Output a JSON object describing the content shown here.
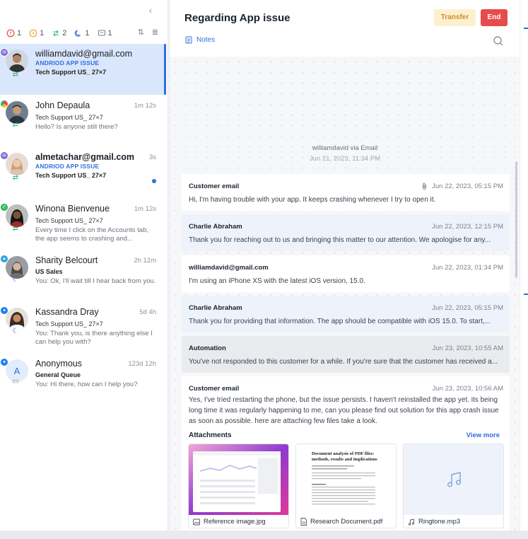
{
  "sidebar": {
    "filters": [
      {
        "icon": "alert-circle-icon",
        "count": "1",
        "color": "#e84b4b"
      },
      {
        "icon": "clock-icon",
        "count": "1",
        "color": "#f0a23a"
      },
      {
        "icon": "transfer-icon",
        "count": "2",
        "color": "#2db36b"
      },
      {
        "icon": "moon-icon",
        "count": "1",
        "color": "#2f6fe0"
      },
      {
        "icon": "message-icon",
        "count": "1",
        "color": "#7b8290"
      }
    ],
    "conversations": [
      {
        "name": "williamdavid@gmail.com",
        "tags": "ANDRIOD  APP ISSUE",
        "queue": "Tech Support US_ 27×7",
        "preview": "",
        "time": "",
        "channel": "email",
        "status": "transfer"
      },
      {
        "name": "John Depaula",
        "tags": "",
        "queue": "Tech Support US_ 27×7",
        "preview": "Hello? Is anyone still there?",
        "time": "1m 12s",
        "channel": "chrome",
        "status": "transfer"
      },
      {
        "name": "almetachar@gmail.com",
        "tags": "ANDRIOD  APP ISSUE",
        "queue": "Tech Support US_ 27×7",
        "preview": "",
        "time": "3s",
        "channel": "email",
        "status": "transfer"
      },
      {
        "name": "Winona Bienvenue",
        "tags": "",
        "queue": "Tech Support US_ 27×7",
        "preview": "Every time I click on the Accounts tab, the app seems to crashing and...",
        "time": "1m 12s",
        "channel": "whatsapp",
        "status": "transfer"
      },
      {
        "name": "Sharity Belcourt",
        "tags": "",
        "queue": "US Sales",
        "preview": "You: Ok, I'll wait till I hear back from you.",
        "time": "2h 12m",
        "channel": "telegram",
        "status": "moon"
      },
      {
        "name": "Kassandra Dray",
        "tags": "",
        "queue": "Tech Support US_ 27×7",
        "preview": "You: Thank you, is there anything else I can help you with?",
        "time": "5d 4h",
        "channel": "messenger",
        "status": "moon"
      },
      {
        "name": "Anonymous",
        "tags": "",
        "queue": "General Queue",
        "preview": "You: Hi there, how can I help you?",
        "time": "123d 12h",
        "channel": "messenger",
        "status": "message",
        "initial": "A"
      }
    ]
  },
  "header": {
    "title": "Regarding App issue",
    "transfer_label": "Transfer",
    "end_label": "End",
    "notes_label": "Notes"
  },
  "thread": {
    "banner_source": "williamdavid via Email",
    "banner_date": "Jun 21, 2023, 11:34 PM",
    "messages": [
      {
        "sender": "Customer email",
        "date": "Jun 22, 2023, 05:15 PM",
        "body": "Hi, I'm having trouble with your app. It keeps crashing whenever I try to open it.",
        "has_attachment_icon": true
      },
      {
        "sender": "Charlie Abraham",
        "date": "Jun 22, 2023, 12:15 PM",
        "body": "Thank you for reaching out to us and bringing this matter to our attention. We apologise for any..."
      },
      {
        "sender": "williamdavid@gmail.com",
        "date": "Jun 22, 2023, 01:34 PM",
        "body": "I'm using an iPhone XS with the latest iOS version, 15.0."
      },
      {
        "sender": "Charlie Abraham",
        "date": "Jun 22, 2023, 05:15 PM",
        "body": "Thank you for providing that information. The app should be compatible with iOS 15.0. To start,..."
      },
      {
        "sender": "Automation",
        "date": "Jun 23, 2023, 10:55 AM",
        "body": "You've not responded to this customer for a while. If you're sure that the customer has received a..."
      },
      {
        "sender": "Customer email",
        "date": "Jun 23, 2023, 10:56 AM",
        "body": "Yes, I've tried restarting the phone, but the issue persists. I haven't reinstalled the app yet. its being long time it was regularly happening to me, can you please find out solution for this app crash issue as soon as possible. here are attaching few files take a look."
      }
    ],
    "attachments_label": "Attachments",
    "view_more_label": "View more",
    "attachments": [
      {
        "name": "Reference image.jpg",
        "icon": "image-icon"
      },
      {
        "name": "Research Document.pdf",
        "icon": "document-icon"
      },
      {
        "name": "Ringtone.mp3",
        "icon": "music-icon"
      }
    ],
    "doc_preview": {
      "title": "Document analysis of PDF files: methods, results and implications"
    }
  },
  "colors": {
    "accent": "#2f6fe0",
    "end": "#e84b4b",
    "transfer_bg": "#fdf0cf",
    "active_row": "#d9e6fb"
  }
}
